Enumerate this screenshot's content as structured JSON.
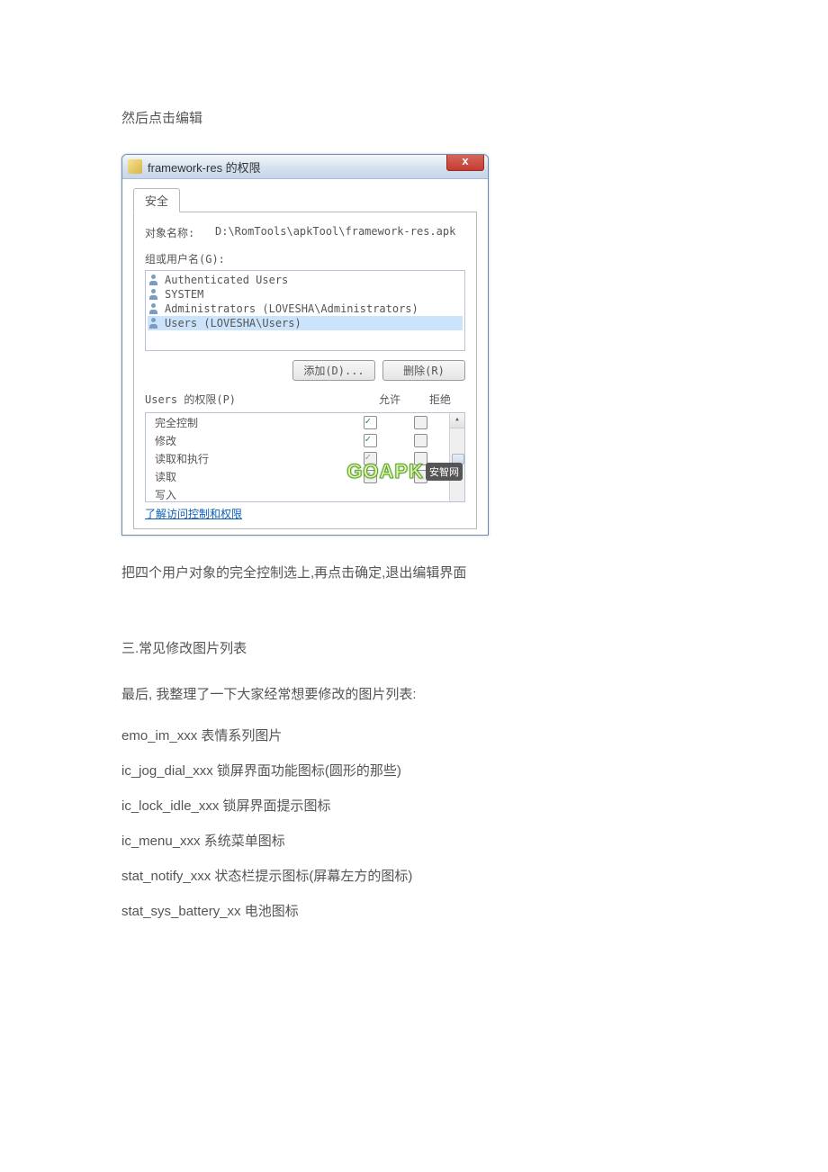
{
  "text1": "然后点击编辑",
  "dialog": {
    "title": "framework-res 的权限",
    "close_x": "x",
    "tab_sec": "安全",
    "object_label": "对象名称:",
    "object_value": "D:\\RomTools\\apkTool\\framework-res.apk",
    "group_label": "组或用户名(G):",
    "users": {
      "u0": "Authenticated Users",
      "u1": "SYSTEM",
      "u2": "Administrators (LOVESHA\\Administrators)",
      "u3": "Users (LOVESHA\\Users)"
    },
    "btn_add": "添加(D)...",
    "btn_remove": "删除(R)",
    "perm_header_name": "Users 的权限(P)",
    "perm_header_allow": "允许",
    "perm_header_deny": "拒绝",
    "perms": {
      "p0": "完全控制",
      "p1": "修改",
      "p2": "读取和执行",
      "p3": "读取",
      "p4": "写入"
    },
    "link": "了解访问控制和权限",
    "watermark": "GOAPK",
    "watermark_badge": "安智网"
  },
  "text2": "把四个用户对象的完全控制选上,再点击确定,退出编辑界面",
  "section3": "三.常见修改图片列表",
  "text3": "最后,  我整理了一下大家经常想要修改的图片列表:",
  "list": {
    "l0": "emo_im_xxx     表情系列图片",
    "l1": "ic_jog_dial_xxx     锁屏界面功能图标(圆形的那些)",
    "l2": "ic_lock_idle_xxx     锁屏界面提示图标",
    "l3": "ic_menu_xxx     系统菜单图标",
    "l4": "stat_notify_xxx     状态栏提示图标(屏幕左方的图标)",
    "l5": "stat_sys_battery_xx     电池图标"
  }
}
